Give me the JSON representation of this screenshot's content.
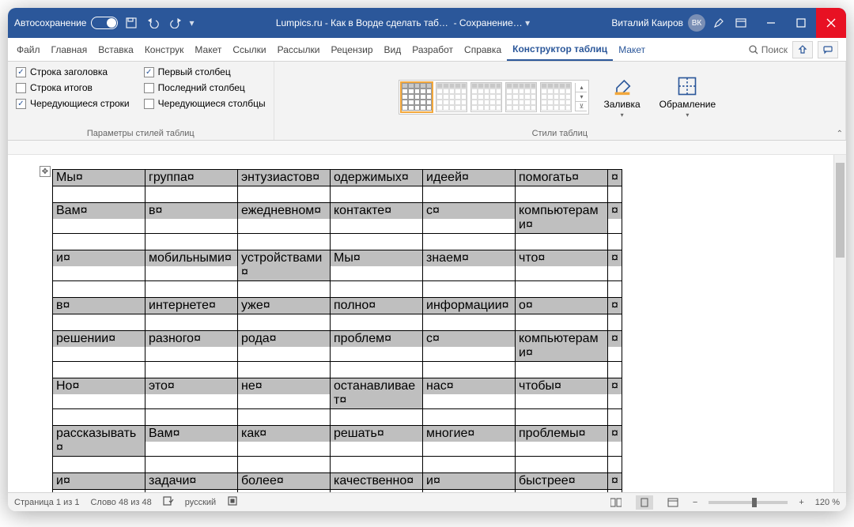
{
  "titlebar": {
    "autosave": "Автосохранение",
    "doc_title": "Lumpics.ru - Как в Ворде сделать таб…",
    "saving": "- Сохранение… ",
    "user": "Виталий Каиров",
    "initials": "ВК"
  },
  "tabs": {
    "file": "Файл",
    "home": "Главная",
    "insert": "Вставка",
    "construct": "Конструк",
    "layout": "Макет",
    "refs": "Ссылки",
    "mail": "Рассылки",
    "review": "Рецензир",
    "view": "Вид",
    "dev": "Разработ",
    "help": "Справка",
    "table_design": "Конструктор таблиц",
    "table_layout": "Макет",
    "search": "Поиск"
  },
  "ribbon": {
    "opts_group": "Параметры стилей таблиц",
    "styles_group": "Стили таблиц",
    "chk_header": "Строка заголовка",
    "chk_total": "Строка итогов",
    "chk_banded_rows": "Чередующиеся строки",
    "chk_first_col": "Первый столбец",
    "chk_last_col": "Последний столбец",
    "chk_banded_cols": "Чередующиеся столбцы",
    "fill": "Заливка",
    "borders": "Обрамление"
  },
  "table": {
    "rows": [
      [
        "Мы¤",
        "группа¤",
        "энтузиастов¤",
        "одержимых¤",
        "идеей¤",
        "помогать¤",
        "¤"
      ],
      [
        "Вам¤",
        "в¤",
        "ежедневном¤",
        "контакте¤",
        "с¤",
        "компьютерами¤",
        "¤"
      ],
      [
        "и¤",
        "мобильными¤",
        "устройствами¤",
        "Мы¤",
        "знаем¤",
        "что¤",
        "¤"
      ],
      [
        "в¤",
        "интернете¤",
        "уже¤",
        "полно¤",
        "информации¤",
        "о¤",
        "¤"
      ],
      [
        "решении¤",
        "разного¤",
        "рода¤",
        "проблем¤",
        "с¤",
        "компьютерами¤",
        "¤"
      ],
      [
        "Но¤",
        "это¤",
        "не¤",
        "останавливает¤",
        "нас¤",
        "чтобы¤",
        "¤"
      ],
      [
        "рассказывать¤",
        "Вам¤",
        "как¤",
        "решать¤",
        "многие¤",
        "проблемы¤",
        "¤"
      ],
      [
        "и¤",
        "задачи¤",
        "более¤",
        "качественно¤",
        "и¤",
        "быстрее¤",
        "¤"
      ]
    ],
    "para_mark": "¶"
  },
  "status": {
    "page": "Страница 1 из 1",
    "words": "Слово 48 из 48",
    "lang": "русский",
    "zoom": "120 %"
  }
}
